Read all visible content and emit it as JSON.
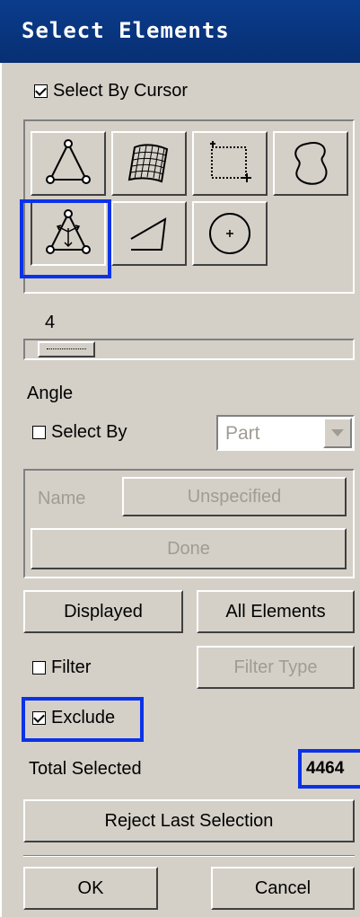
{
  "window": {
    "title": "Select Elements"
  },
  "select_by_cursor": {
    "label": "Select By Cursor",
    "checked": true
  },
  "tools": [
    {
      "name": "node-triangle-icon"
    },
    {
      "name": "surface-mesh-icon"
    },
    {
      "name": "box-select-icon"
    },
    {
      "name": "freehand-lasso-icon"
    },
    {
      "name": "node-triangle-arrows-icon"
    },
    {
      "name": "polygon-select-icon"
    },
    {
      "name": "circle-select-icon"
    }
  ],
  "slider": {
    "value_label": "4",
    "value": 4
  },
  "angle": {
    "label": "Angle"
  },
  "select_by": {
    "label": "Select By",
    "checked": false,
    "option": "Part"
  },
  "name_row": {
    "label": "Name",
    "value": "Unspecified"
  },
  "done_button": {
    "label": "Done"
  },
  "displayed_button": {
    "label": "Displayed"
  },
  "all_elements_button": {
    "label": "All Elements"
  },
  "filter": {
    "label": "Filter",
    "checked": false
  },
  "filter_type_button": {
    "label": "Filter Type"
  },
  "exclude": {
    "label": "Exclude",
    "checked": true
  },
  "total_selected": {
    "label": "Total Selected",
    "value": "4464"
  },
  "reject_button": {
    "label": "Reject Last Selection"
  },
  "ok_button": {
    "label": "OK"
  },
  "cancel_button": {
    "label": "Cancel"
  },
  "colors": {
    "title_bar": "#0a3c8c",
    "highlight": "#0b32e8",
    "face": "#d4d0c8",
    "disabled_text": "#a09c94"
  }
}
